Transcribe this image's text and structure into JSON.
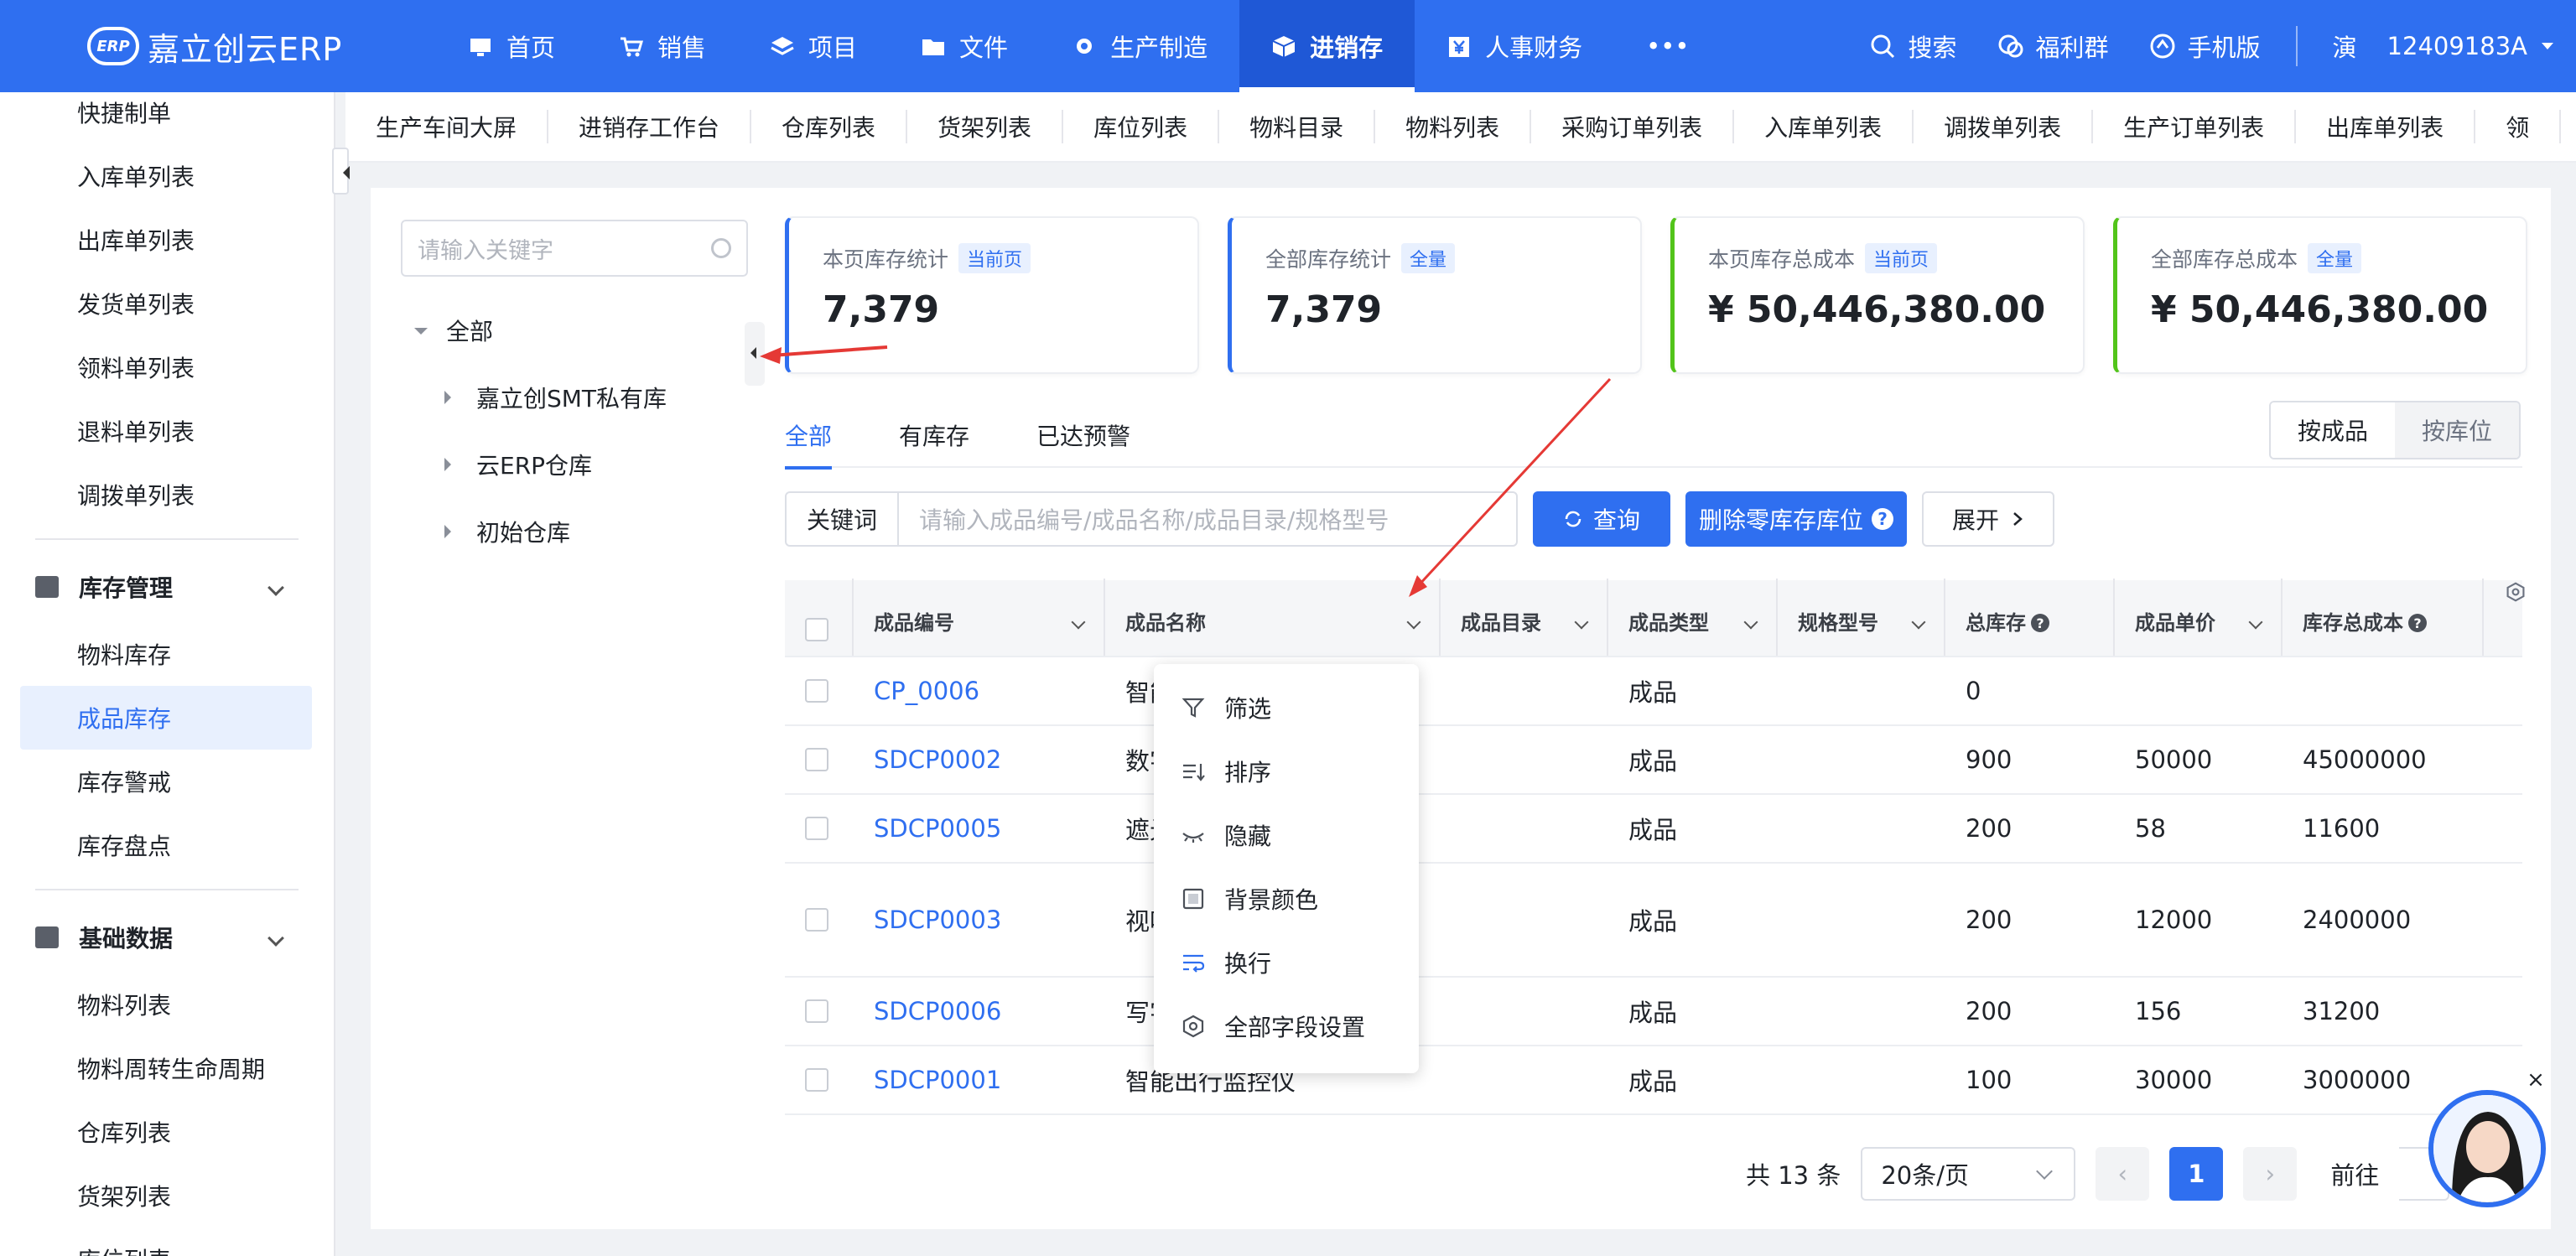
{
  "app": {
    "logo_badge": "ERP",
    "logo_text": "嘉立创云ERP"
  },
  "nav": [
    {
      "label": "首页",
      "icon": "monitor-icon"
    },
    {
      "label": "销售",
      "icon": "cart-icon"
    },
    {
      "label": "项目",
      "icon": "layers-icon"
    },
    {
      "label": "文件",
      "icon": "folder-icon"
    },
    {
      "label": "生产制造",
      "icon": "gear-icon"
    },
    {
      "label": "进销存",
      "icon": "box-icon",
      "active": true
    },
    {
      "label": "人事财务",
      "icon": "yen-icon"
    },
    {
      "label": "•••",
      "icon": "more-icon"
    }
  ],
  "topright": {
    "search": "搜索",
    "welfare": "福利群",
    "mobile": "手机版",
    "user_initial": "演",
    "user_id": "12409183A"
  },
  "sidebar": {
    "items_top": [
      "快捷制单",
      "入库单列表",
      "出库单列表",
      "发货单列表",
      "领料单列表",
      "退料单列表",
      "调拨单列表"
    ],
    "group1": "库存管理",
    "items_mid": [
      "物料库存",
      "成品库存",
      "库存警戒",
      "库存盘点"
    ],
    "group2": "基础数据",
    "items_bot": [
      "物料列表",
      "物料周转生命周期",
      "仓库列表",
      "货架列表",
      "库位列表"
    ]
  },
  "page_tabs": [
    "生产车间大屏",
    "进销存工作台",
    "仓库列表",
    "货架列表",
    "库位列表",
    "物料目录",
    "物料列表",
    "采购订单列表",
    "入库单列表",
    "调拨单列表",
    "生产订单列表",
    "出库单列表",
    "领"
  ],
  "tree": {
    "search_placeholder": "请输入关键字",
    "root": "全部",
    "children": [
      "嘉立创SMT私有库",
      "云ERP仓库",
      "初始仓库"
    ]
  },
  "stats": [
    {
      "label": "本页库存统计",
      "tag": "当前页",
      "value": "7,379",
      "color": "#2f6ff0"
    },
    {
      "label": "全部库存统计",
      "tag": "全量",
      "value": "7,379",
      "color": "#2f6ff0"
    },
    {
      "label": "本页库存总成本",
      "tag": "当前页",
      "value": "¥ 50,446,380.00",
      "color": "#52c41a"
    },
    {
      "label": "全部库存总成本",
      "tag": "全量",
      "value": "¥ 50,446,380.00",
      "color": "#52c41a"
    }
  ],
  "filter_tabs": [
    "全部",
    "有库存",
    "已达预警"
  ],
  "segment": {
    "on": "按成品",
    "off": "按库位"
  },
  "query": {
    "label": "关键词",
    "placeholder": "请输入成品编号/成品名称/成品目录/规格型号",
    "search_btn": "查询",
    "delete_btn": "删除零库存库位",
    "expand_btn": "展开"
  },
  "table": {
    "headers": [
      "成品编号",
      "成品名称",
      "成品目录",
      "成品类型",
      "规格型号",
      "总库存",
      "成品单价",
      "库存总成本"
    ],
    "rows": [
      {
        "code": "CP_0006",
        "name": "智能",
        "type": "成品",
        "stock": "0",
        "price": "",
        "cost": "",
        "h": 82
      },
      {
        "code": "SDCP0002",
        "name": "数字",
        "type": "成品",
        "stock": "900",
        "price": "50000",
        "cost": "45000000",
        "h": 82
      },
      {
        "code": "SDCP0005",
        "name": "遮光",
        "type": "成品",
        "stock": "200",
        "price": "58",
        "cost": "11600",
        "h": 82
      },
      {
        "code": "SDCP0003",
        "name": "视听统",
        "type": "成品",
        "stock": "200",
        "price": "12000",
        "cost": "2400000",
        "h": 136
      },
      {
        "code": "SDCP0006",
        "name": "写字",
        "type": "成品",
        "stock": "200",
        "price": "156",
        "cost": "31200",
        "h": 82
      },
      {
        "code": "SDCP0001",
        "name": "智能出行监控仪",
        "type": "成品",
        "stock": "100",
        "price": "30000",
        "cost": "3000000",
        "h": 82
      }
    ]
  },
  "context_menu": [
    {
      "label": "筛选",
      "icon": "filter-icon"
    },
    {
      "label": "排序",
      "icon": "sort-icon"
    },
    {
      "label": "隐藏",
      "icon": "eye-closed-icon"
    },
    {
      "label": "背景颜色",
      "icon": "palette-icon"
    },
    {
      "label": "换行",
      "icon": "wrap-icon"
    },
    {
      "label": "全部字段设置",
      "icon": "settings-hex-icon"
    }
  ],
  "pager": {
    "total": "共 13 条",
    "page_size": "20条/页",
    "current": "1",
    "goto": "前往"
  },
  "colors": {
    "primary": "#2f6ff0",
    "green": "#52c41a",
    "annotation": "#e53935"
  }
}
